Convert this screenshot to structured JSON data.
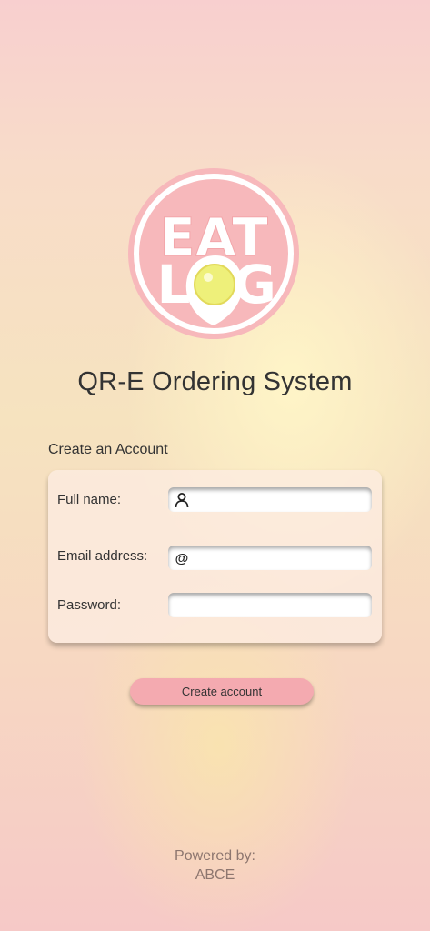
{
  "logo": {
    "line1": "EAT",
    "line2_left": "L",
    "line2_right": "G"
  },
  "title": "QR-E Ordering System",
  "form": {
    "heading": "Create an Account",
    "fields": [
      {
        "label": "Full name:",
        "icon": "person-icon",
        "value": ""
      },
      {
        "label": "Email address:",
        "icon": "at-icon",
        "icon_glyph": "@",
        "value": ""
      },
      {
        "label": "Password:",
        "value": ""
      }
    ],
    "submit_label": "Create account"
  },
  "footer": {
    "line1": "Powered by:",
    "line2": "ABCE"
  },
  "colors": {
    "logo_pink": "#f6b5b8",
    "button": "#f4aab0",
    "yolk": "#eef07a"
  }
}
